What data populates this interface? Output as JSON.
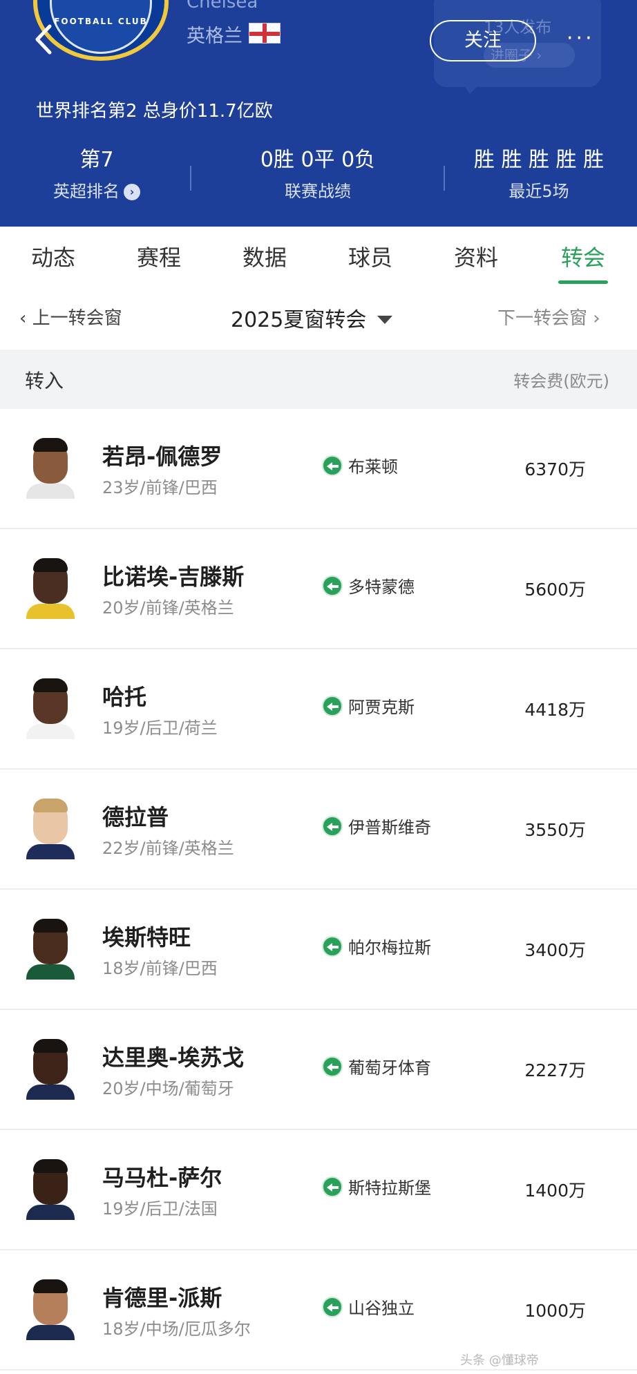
{
  "header": {
    "team_en": "Chelsea",
    "country": "英格兰",
    "crest_text": "FOOTBALL CLUB",
    "follow_label": "关注",
    "more_label": "···",
    "bubble_text": "13人发布",
    "bubble_link": "进圈子 ›",
    "rank_line": "世界排名第2  总身价11.7亿欧",
    "stats": [
      {
        "value": "第7",
        "label": "英超排名"
      },
      {
        "value": "0胜 0平 0负",
        "label": "联赛战绩"
      },
      {
        "value": "胜 胜 胜 胜 胜",
        "label": "最近5场"
      }
    ],
    "back_icon": "back-chevron-icon",
    "flag_icon": "england-flag-icon"
  },
  "tabs": [
    {
      "label": "动态",
      "active": false
    },
    {
      "label": "赛程",
      "active": false
    },
    {
      "label": "数据",
      "active": false
    },
    {
      "label": "球员",
      "active": false
    },
    {
      "label": "资料",
      "active": false
    },
    {
      "label": "转会",
      "active": true
    }
  ],
  "window_nav": {
    "prev": "‹ 上一转会窗",
    "current": "2025夏窗转会",
    "next": "下一转会窗 ›"
  },
  "section": {
    "title": "转入",
    "fee_header": "转会费(欧元)"
  },
  "transfers": [
    {
      "name": "若昂-佩德罗",
      "info": "23岁/前锋/巴西",
      "from": "布莱顿",
      "fee": "6370万"
    },
    {
      "name": "比诺埃-吉滕斯",
      "info": "20岁/前锋/英格兰",
      "from": "多特蒙德",
      "fee": "5600万"
    },
    {
      "name": "哈托",
      "info": "19岁/后卫/荷兰",
      "from": "阿贾克斯",
      "fee": "4418万"
    },
    {
      "name": "德拉普",
      "info": "22岁/前锋/英格兰",
      "from": "伊普斯维奇",
      "fee": "3550万"
    },
    {
      "name": "埃斯特旺",
      "info": "18岁/前锋/巴西",
      "from": "帕尔梅拉斯",
      "fee": "3400万"
    },
    {
      "name": "达里奥-埃苏戈",
      "info": "20岁/中场/葡萄牙",
      "from": "葡萄牙体育",
      "fee": "2227万"
    },
    {
      "name": "马马杜-萨尔",
      "info": "19岁/后卫/法国",
      "from": "斯特拉斯堡",
      "fee": "1400万"
    },
    {
      "name": "肯德里-派斯",
      "info": "18岁/中场/厄瓜多尔",
      "from": "山谷独立",
      "fee": "1000万"
    }
  ],
  "colors": {
    "header_bg": "#1d3f99",
    "accent_green": "#2aa15b"
  },
  "watermark": "头条 @懂球帝"
}
